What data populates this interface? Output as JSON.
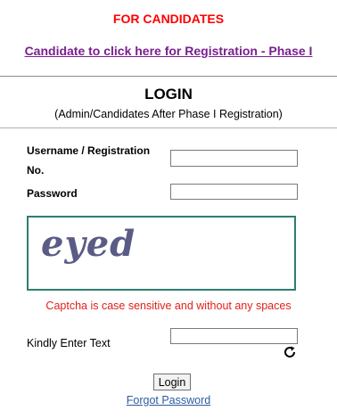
{
  "header": {
    "for_candidates": "FOR CANDIDATES",
    "registration_link": "Candidate to click here for Registration - Phase I"
  },
  "login": {
    "title": "LOGIN",
    "subtitle": "(Admin/Candidates After Phase I Registration)"
  },
  "form": {
    "username_label": "Username / Registration No.",
    "username_value": "",
    "password_label": "Password",
    "password_value": "",
    "captcha_image_text": "eyed",
    "captcha_note": "Captcha is case sensitive and without any spaces",
    "captcha_label": "Kindly Enter Text",
    "captcha_value": "",
    "refresh_icon": "refresh-icon",
    "login_button": "Login",
    "forgot_password": "Forgot Password"
  },
  "colors": {
    "alert_red": "#ff0000",
    "link_purple": "#7a1f8f",
    "captcha_border": "#2e7d72",
    "captcha_text": "#5a5c86",
    "link_blue": "#2c5aa0"
  }
}
